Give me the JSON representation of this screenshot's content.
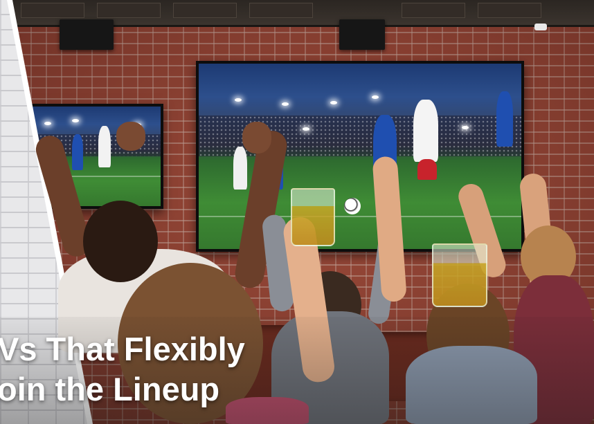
{
  "headline": {
    "line1": "Vs That Flexibly",
    "line2": "oin the Lineup"
  },
  "colors": {
    "brick": "#9a4a3a",
    "headline_text": "#ffffff",
    "pitch": "#3f8c35",
    "team_blue": "#1f4fb0",
    "team_white_red": "#c8232c"
  },
  "icons": [
    "security-camera-icon",
    "speaker-icon"
  ]
}
